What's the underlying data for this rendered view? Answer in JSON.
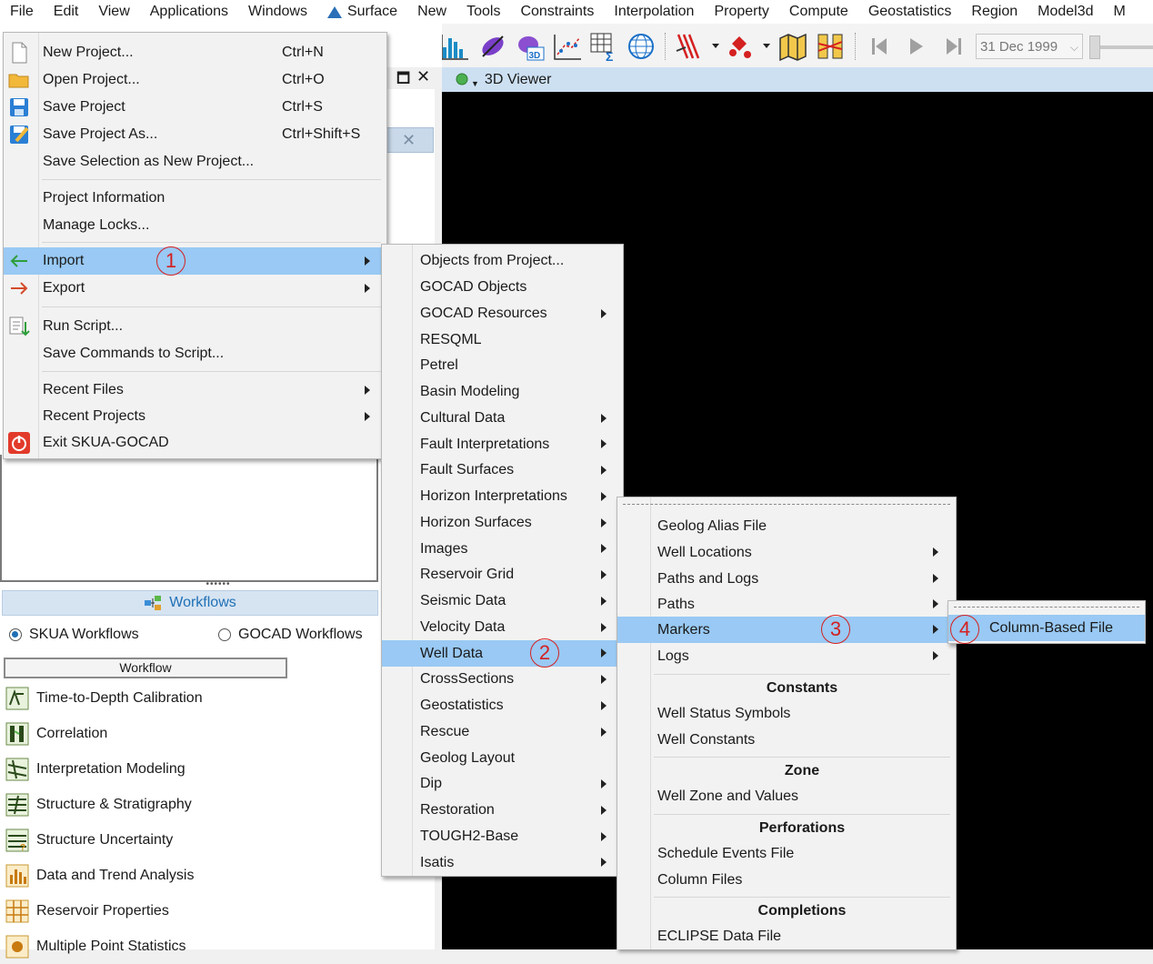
{
  "menubar": [
    "File",
    "Edit",
    "View",
    "Applications",
    "Windows",
    "Surface",
    "New",
    "Tools",
    "Constraints",
    "Interpolation",
    "Property",
    "Compute",
    "Geostatistics",
    "Region",
    "Model3d",
    "M"
  ],
  "toolbar": {
    "date": "31 Dec 1999"
  },
  "viewer": {
    "title": "3D Viewer"
  },
  "file_menu": {
    "items": [
      {
        "label": "New Project...",
        "shortcut": "Ctrl+N",
        "icon": "new-file-icon"
      },
      {
        "label": "Open Project...",
        "shortcut": "Ctrl+O",
        "icon": "folder-icon"
      },
      {
        "label": "Save Project",
        "shortcut": "Ctrl+S",
        "icon": "save-icon"
      },
      {
        "label": "Save Project As...",
        "shortcut": "Ctrl+Shift+S",
        "icon": "save-as-icon"
      },
      {
        "label": "Save Selection as New Project..."
      },
      {
        "label": "Project Information"
      },
      {
        "label": "Manage Locks..."
      },
      {
        "label": "Import",
        "submenu": true,
        "icon": "import-arrow-icon"
      },
      {
        "label": "Export",
        "submenu": true,
        "icon": "export-arrow-icon"
      },
      {
        "label": "Run Script...",
        "icon": "script-icon"
      },
      {
        "label": "Save Commands to Script..."
      },
      {
        "label": "Recent Files",
        "submenu": true
      },
      {
        "label": "Recent Projects",
        "submenu": true
      },
      {
        "label": "Exit SKUA-GOCAD",
        "icon": "power-icon"
      }
    ]
  },
  "import_menu": {
    "items": [
      "Objects from Project...",
      "GOCAD Objects",
      "GOCAD Resources",
      "RESQML",
      "Petrel",
      "Basin Modeling",
      "Cultural Data",
      "Fault Interpretations",
      "Fault Surfaces",
      "Horizon Interpretations",
      "Horizon Surfaces",
      "Images",
      "Reservoir Grid",
      "Seismic Data",
      "Velocity Data",
      "Well Data",
      "CrossSections",
      "Geostatistics",
      "Rescue",
      "Geolog Layout",
      "Dip",
      "Restoration",
      "TOUGH2-Base",
      "Isatis"
    ]
  },
  "welldata_menu": {
    "items": [
      "Geolog Alias File",
      "Well Locations",
      "Paths and Logs",
      "Paths",
      "Markers",
      "Logs"
    ],
    "sections": [
      {
        "header": "Constants",
        "items": [
          "Well Status Symbols",
          "Well Constants"
        ]
      },
      {
        "header": "Zone",
        "items": [
          "Well Zone and Values"
        ]
      },
      {
        "header": "Perforations",
        "items": [
          "Schedule Events File",
          "Column Files"
        ]
      },
      {
        "header": "Completions",
        "items": [
          "ECLIPSE Data File"
        ]
      }
    ]
  },
  "markers_menu": {
    "items": [
      "Column-Based File"
    ]
  },
  "steps": [
    "1",
    "2",
    "3",
    "4"
  ],
  "workflows": {
    "header": "Workflows",
    "radio_skua": "SKUA Workflows",
    "radio_gocad": "GOCAD Workflows",
    "column": "Workflow",
    "items": [
      "Time-to-Depth Calibration",
      "Correlation",
      "Interpretation Modeling",
      "Structure & Stratigraphy",
      "Structure Uncertainty",
      "Data and Trend Analysis",
      "Reservoir Properties",
      "Multiple Point Statistics"
    ]
  }
}
